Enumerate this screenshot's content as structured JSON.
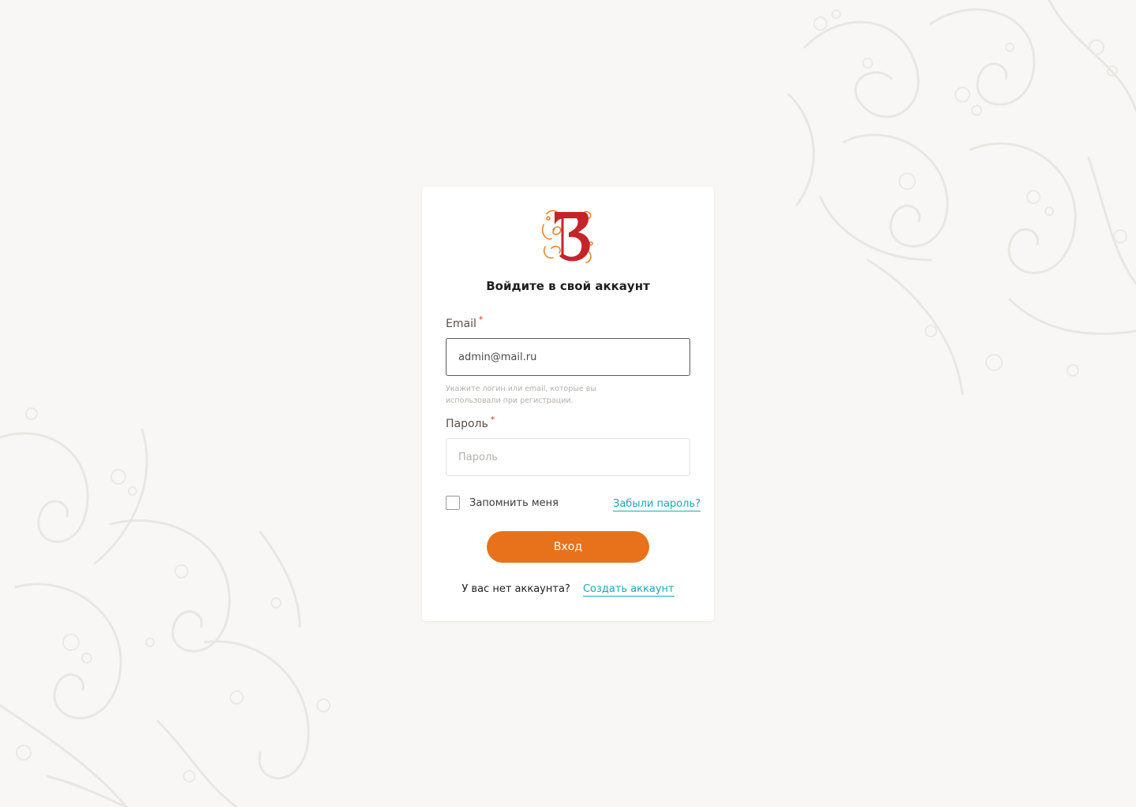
{
  "login": {
    "title": "Войдите в свой аккаунт",
    "email": {
      "label": "Email",
      "required_mark": "*",
      "value": "admin@mail.ru",
      "hint": "Укажите логин или email, которые вы использовали при регистрации."
    },
    "password": {
      "label": "Пароль",
      "required_mark": "*",
      "value": "",
      "placeholder": "Пароль"
    },
    "remember_label": "Запомнить меня",
    "remember_checked": false,
    "forgot_link": "Забыли пароль?",
    "submit_label": "Вход",
    "signup_prompt": "У вас нет аккаунта?",
    "signup_link": "Создать аккаунт"
  },
  "colors": {
    "accent": "#e8721b",
    "link": "#1fa5b8",
    "required": "#d0382b",
    "logo_red": "#c4252a",
    "logo_orange": "#e8862c",
    "background": "#f9f7f5"
  }
}
